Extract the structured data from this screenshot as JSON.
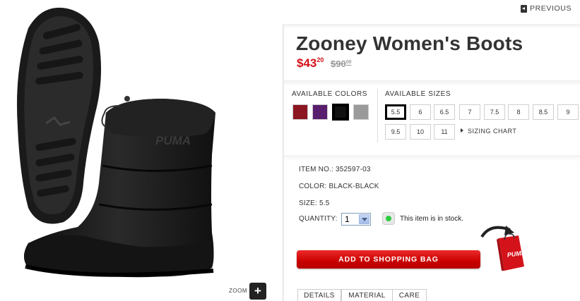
{
  "nav": {
    "previous_label": "PREVIOUS"
  },
  "product": {
    "title": "Zooney Women's Boots",
    "price_main": "$43",
    "price_cents": "20",
    "old_price_main": "$90",
    "old_price_cents": "00",
    "image_brand_text": "PUMA"
  },
  "zoom": {
    "label": "ZOOM",
    "button_label": "+"
  },
  "colors": {
    "label": "AVAILABLE COLORS",
    "swatches": [
      {
        "name": "red",
        "color": "#8b1520"
      },
      {
        "name": "purple",
        "color": "#5a1e6e"
      },
      {
        "name": "black",
        "color": "#111111",
        "selected": true
      },
      {
        "name": "gray",
        "color": "#9a9a9a"
      }
    ]
  },
  "sizes": {
    "label": "AVAILABLE SIZES",
    "items": [
      "5.5",
      "6",
      "6.5",
      "7",
      "7.5",
      "8",
      "8.5",
      "9",
      "9.5",
      "10",
      "11"
    ],
    "selected": "5.5",
    "sizing_chart_label": "SIZING CHART"
  },
  "details": {
    "item_no": "ITEM NO.: 352597-03",
    "color": "COLOR: BLACK-BLACK",
    "size": "SIZE: 5.5",
    "quantity_label": "QUANTITY:",
    "quantity_value": "1",
    "stock_text": "This item is in stock."
  },
  "cart": {
    "add_button_label": "ADD TO SHOPPING BAG",
    "bag_brand_text": "PUMA"
  },
  "tabs": [
    {
      "label": "DETAILS"
    },
    {
      "label": "MATERIAL"
    },
    {
      "label": "CARE"
    }
  ],
  "theme": {
    "accent": "#d4121a"
  }
}
